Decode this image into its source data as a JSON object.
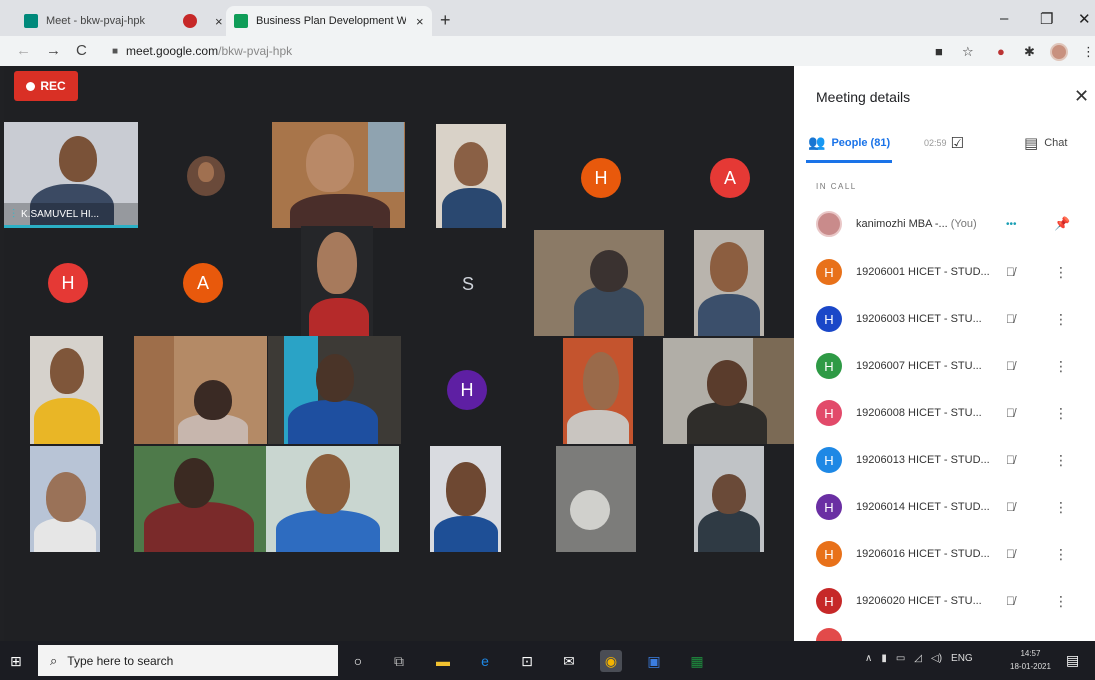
{
  "browser": {
    "tabs": [
      {
        "title": "Meet - bkw-pvaj-hpk",
        "favicon_color": "#00897b"
      },
      {
        "title": "",
        "favicon_color": "#c62828"
      },
      {
        "title": "Business Plan Development Wo",
        "favicon_color": "#0f9d58"
      }
    ],
    "new_tab": "+",
    "close_glyph": "×",
    "window_controls": {
      "minimize": "–",
      "maximize": "❐",
      "close": "✕"
    },
    "nav": {
      "back": "←",
      "forward": "→",
      "reload": "C"
    },
    "url_host": "meet.google.com",
    "url_path": "/bkw-pvaj-hpk"
  },
  "meet": {
    "rec_label": "REC",
    "active_speaker_name": "K.SAMUVEL HI...",
    "letter_tiles": [
      "H",
      "A",
      "H",
      "A",
      "S",
      "H"
    ]
  },
  "panel": {
    "title": "Meeting details",
    "close_glyph": "✕",
    "people_tab": "People (81)",
    "clock_label": "02:59",
    "chat_tab": "Chat",
    "section_label": "IN CALL",
    "participants": [
      {
        "name": "kanimozhi MBA -...",
        "suffix": "(You)",
        "initial": "",
        "color": "#c98b8b"
      },
      {
        "name": "19206001 HICET - STUD...",
        "initial": "H",
        "color": "#e8711a"
      },
      {
        "name": "19206003 HICET - STU...",
        "initial": "H",
        "color": "#1a47c8"
      },
      {
        "name": "19206007 HICET - STU...",
        "initial": "H",
        "color": "#2e9a45"
      },
      {
        "name": "19206008 HICET - STU...",
        "initial": "H",
        "color": "#e24a6a"
      },
      {
        "name": "19206013 HICET - STUD...",
        "initial": "H",
        "color": "#1e88e5"
      },
      {
        "name": "19206014 HICET - STUD...",
        "initial": "H",
        "color": "#6a2fa3"
      },
      {
        "name": "19206016 HICET - STUD...",
        "initial": "H",
        "color": "#e8711a"
      },
      {
        "name": "19206020 HICET - STU...",
        "initial": "H",
        "color": "#c62828"
      }
    ]
  },
  "taskbar": {
    "search_placeholder": "Type here to search",
    "language": "ENG",
    "time": "14:57",
    "date": "18-01-2021"
  }
}
